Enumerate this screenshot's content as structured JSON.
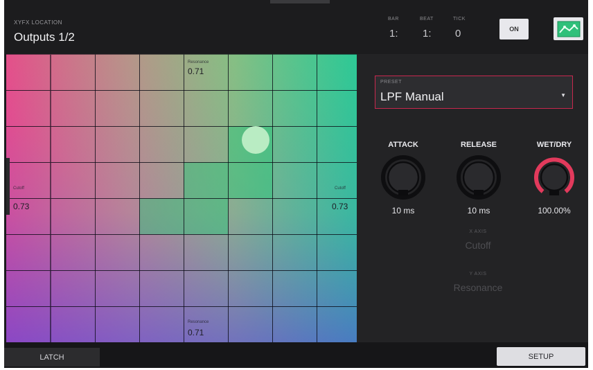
{
  "header": {
    "location_label": "XYFX LOCATION",
    "location_value": "Outputs 1/2",
    "timecode": [
      {
        "label": "BAR",
        "value": "1:"
      },
      {
        "label": "BEAT",
        "value": "1:"
      },
      {
        "label": "TICK",
        "value": "0"
      }
    ],
    "on_label": "ON",
    "view_icon": "xy-graph-icon",
    "accent_color": "#2fc07a"
  },
  "pad": {
    "top": {
      "label": "Resonance",
      "value": "0.71"
    },
    "bottom": {
      "label": "Resonance",
      "value": "0.71"
    },
    "left": {
      "label": "Cutoff",
      "value": "0.73"
    },
    "right": {
      "label": "Cutoff",
      "value": "0.73"
    }
  },
  "panel": {
    "preset_label": "PRESET",
    "preset_value": "LPF Manual",
    "knobs": [
      {
        "label": "ATTACK",
        "value": "10 ms"
      },
      {
        "label": "RELEASE",
        "value": "10 ms"
      },
      {
        "label": "WET/DRY",
        "value": "100.00%",
        "color": "#e23a5c"
      }
    ],
    "x_axis": {
      "label": "X AXIS",
      "value": "Cutoff"
    },
    "y_axis": {
      "label": "Y AXIS",
      "value": "Resonance"
    }
  },
  "footer": {
    "latch_label": "LATCH",
    "setup_label": "SETUP"
  }
}
